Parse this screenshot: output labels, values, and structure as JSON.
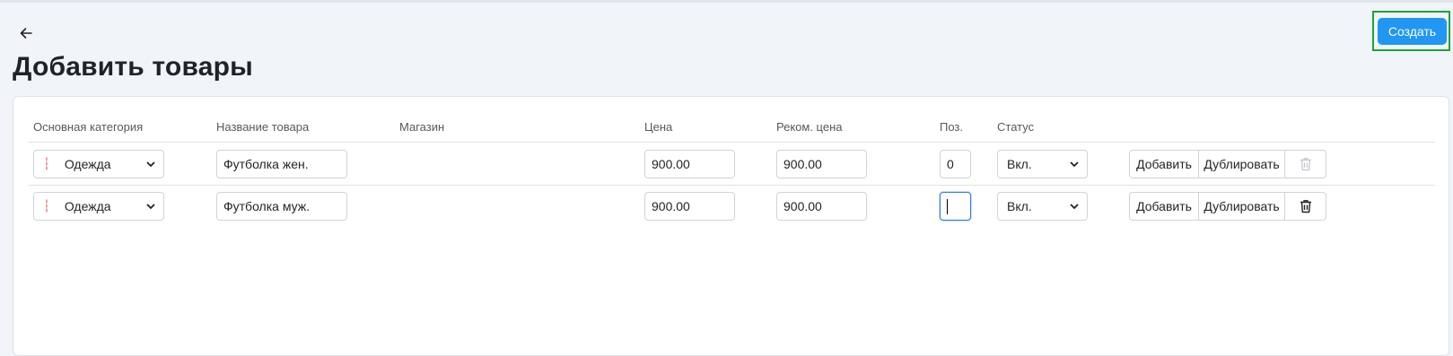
{
  "page": {
    "title": "Добавить товары",
    "create_label": "Создать"
  },
  "table": {
    "headers": {
      "category": "Основная категория",
      "name": "Название товара",
      "shop": "Магазин",
      "price": "Цена",
      "rec_price": "Реком. цена",
      "pos": "Поз.",
      "status": "Статус"
    },
    "rows": [
      {
        "category": "Одежда",
        "name": "Футболка жен.",
        "shop": "",
        "price": "900.00",
        "rec_price": "900.00",
        "pos": "0",
        "status": "Вкл.",
        "add": "Добавить",
        "duplicate": "Дублировать",
        "delete_enabled": false
      },
      {
        "category": "Одежда",
        "name": "Футболка муж.",
        "shop": "",
        "price": "900.00",
        "rec_price": "900.00",
        "pos": "",
        "status": "Вкл.",
        "add": "Добавить",
        "duplicate": "Дублировать",
        "delete_enabled": true
      }
    ]
  },
  "icons": {
    "back": "arrow-left-icon",
    "drag": "drag-handle-icon",
    "chevron": "chevron-down-icon",
    "trash": "trash-icon"
  },
  "colors": {
    "primary": "#2196f3",
    "highlight": "#1aa33a",
    "drag": "#d94b4b",
    "focus": "#2f7de1"
  }
}
